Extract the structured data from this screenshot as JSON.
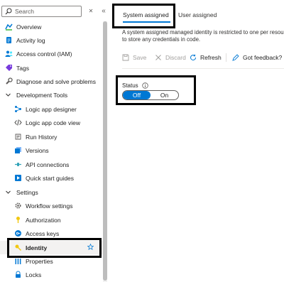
{
  "search": {
    "placeholder": "Search"
  },
  "nav": {
    "collapse_glyph": "«",
    "clear_glyph": "✕",
    "items": [
      {
        "label": "Overview",
        "icon": "overview-icon"
      },
      {
        "label": "Activity log",
        "icon": "activity-log-icon"
      },
      {
        "label": "Access control (IAM)",
        "icon": "iam-icon"
      },
      {
        "label": "Tags",
        "icon": "tag-icon"
      },
      {
        "label": "Diagnose and solve problems",
        "icon": "wrench-icon"
      },
      {
        "label": "Development Tools",
        "icon": "chevron-down-icon",
        "group": true
      },
      {
        "label": "Logic app designer",
        "icon": "designer-icon"
      },
      {
        "label": "Logic app code view",
        "icon": "code-icon"
      },
      {
        "label": "Run History",
        "icon": "history-icon"
      },
      {
        "label": "Versions",
        "icon": "versions-icon"
      },
      {
        "label": "API connections",
        "icon": "api-icon"
      },
      {
        "label": "Quick start guides",
        "icon": "quickstart-icon"
      },
      {
        "label": "Settings",
        "icon": "chevron-down-icon",
        "group": true
      },
      {
        "label": "Workflow settings",
        "icon": "gear-icon"
      },
      {
        "label": "Authorization",
        "icon": "key-icon"
      },
      {
        "label": "Access keys",
        "icon": "access-keys-icon"
      },
      {
        "label": "Identity",
        "icon": "identity-icon",
        "selected": true
      },
      {
        "label": "Properties",
        "icon": "properties-icon"
      },
      {
        "label": "Locks",
        "icon": "lock-icon"
      }
    ]
  },
  "tabs": [
    {
      "label": "System assigned",
      "active": true
    },
    {
      "label": "User assigned",
      "active": false
    }
  ],
  "description": {
    "line1": "A system assigned managed identity is restricted to one per resou",
    "line2": "to store any credentials in code."
  },
  "toolbar": {
    "save": "Save",
    "discard": "Discard",
    "refresh": "Refresh",
    "feedback": "Got feedback?"
  },
  "status": {
    "label": "Status",
    "off_label": "Off",
    "on_label": "On",
    "selected": "Off"
  },
  "colors": {
    "accent": "#0078d4",
    "selected_bg": "#f3f2f1",
    "highlight_border": "#000000"
  }
}
